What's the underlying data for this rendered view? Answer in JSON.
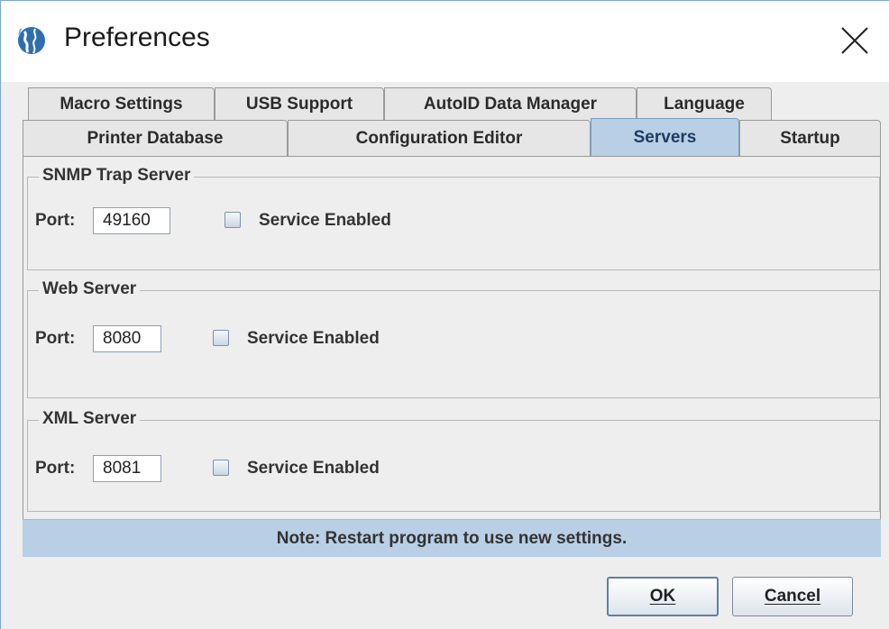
{
  "window": {
    "title": "Preferences"
  },
  "icons": {
    "app": "globe-icon",
    "close": "close-icon"
  },
  "tabs": {
    "row_back": [
      {
        "label": "Macro Settings"
      },
      {
        "label": "USB Support"
      },
      {
        "label": "AutoID Data Manager"
      },
      {
        "label": "Language"
      }
    ],
    "row_front": [
      {
        "label": "Printer Database"
      },
      {
        "label": "Configuration Editor"
      },
      {
        "label": "Servers",
        "selected": true
      },
      {
        "label": "Startup"
      }
    ]
  },
  "servers": [
    {
      "title": "SNMP Trap Server",
      "port_label": "Port:",
      "port": "49160",
      "service_label": "Service Enabled",
      "enabled": false
    },
    {
      "title": "Web Server",
      "port_label": "Port:",
      "port": "8080",
      "service_label": "Service Enabled",
      "enabled": false
    },
    {
      "title": "XML Server",
      "port_label": "Port:",
      "port": "8081",
      "service_label": "Service Enabled",
      "enabled": false
    }
  ],
  "note": "Note: Restart program to use new settings.",
  "buttons": {
    "ok": "OK",
    "cancel": "Cancel"
  },
  "colors": {
    "selected_tab": "#b8cfe5",
    "note_bar": "#b8cfe5",
    "window_bg": "#eeeeee"
  }
}
